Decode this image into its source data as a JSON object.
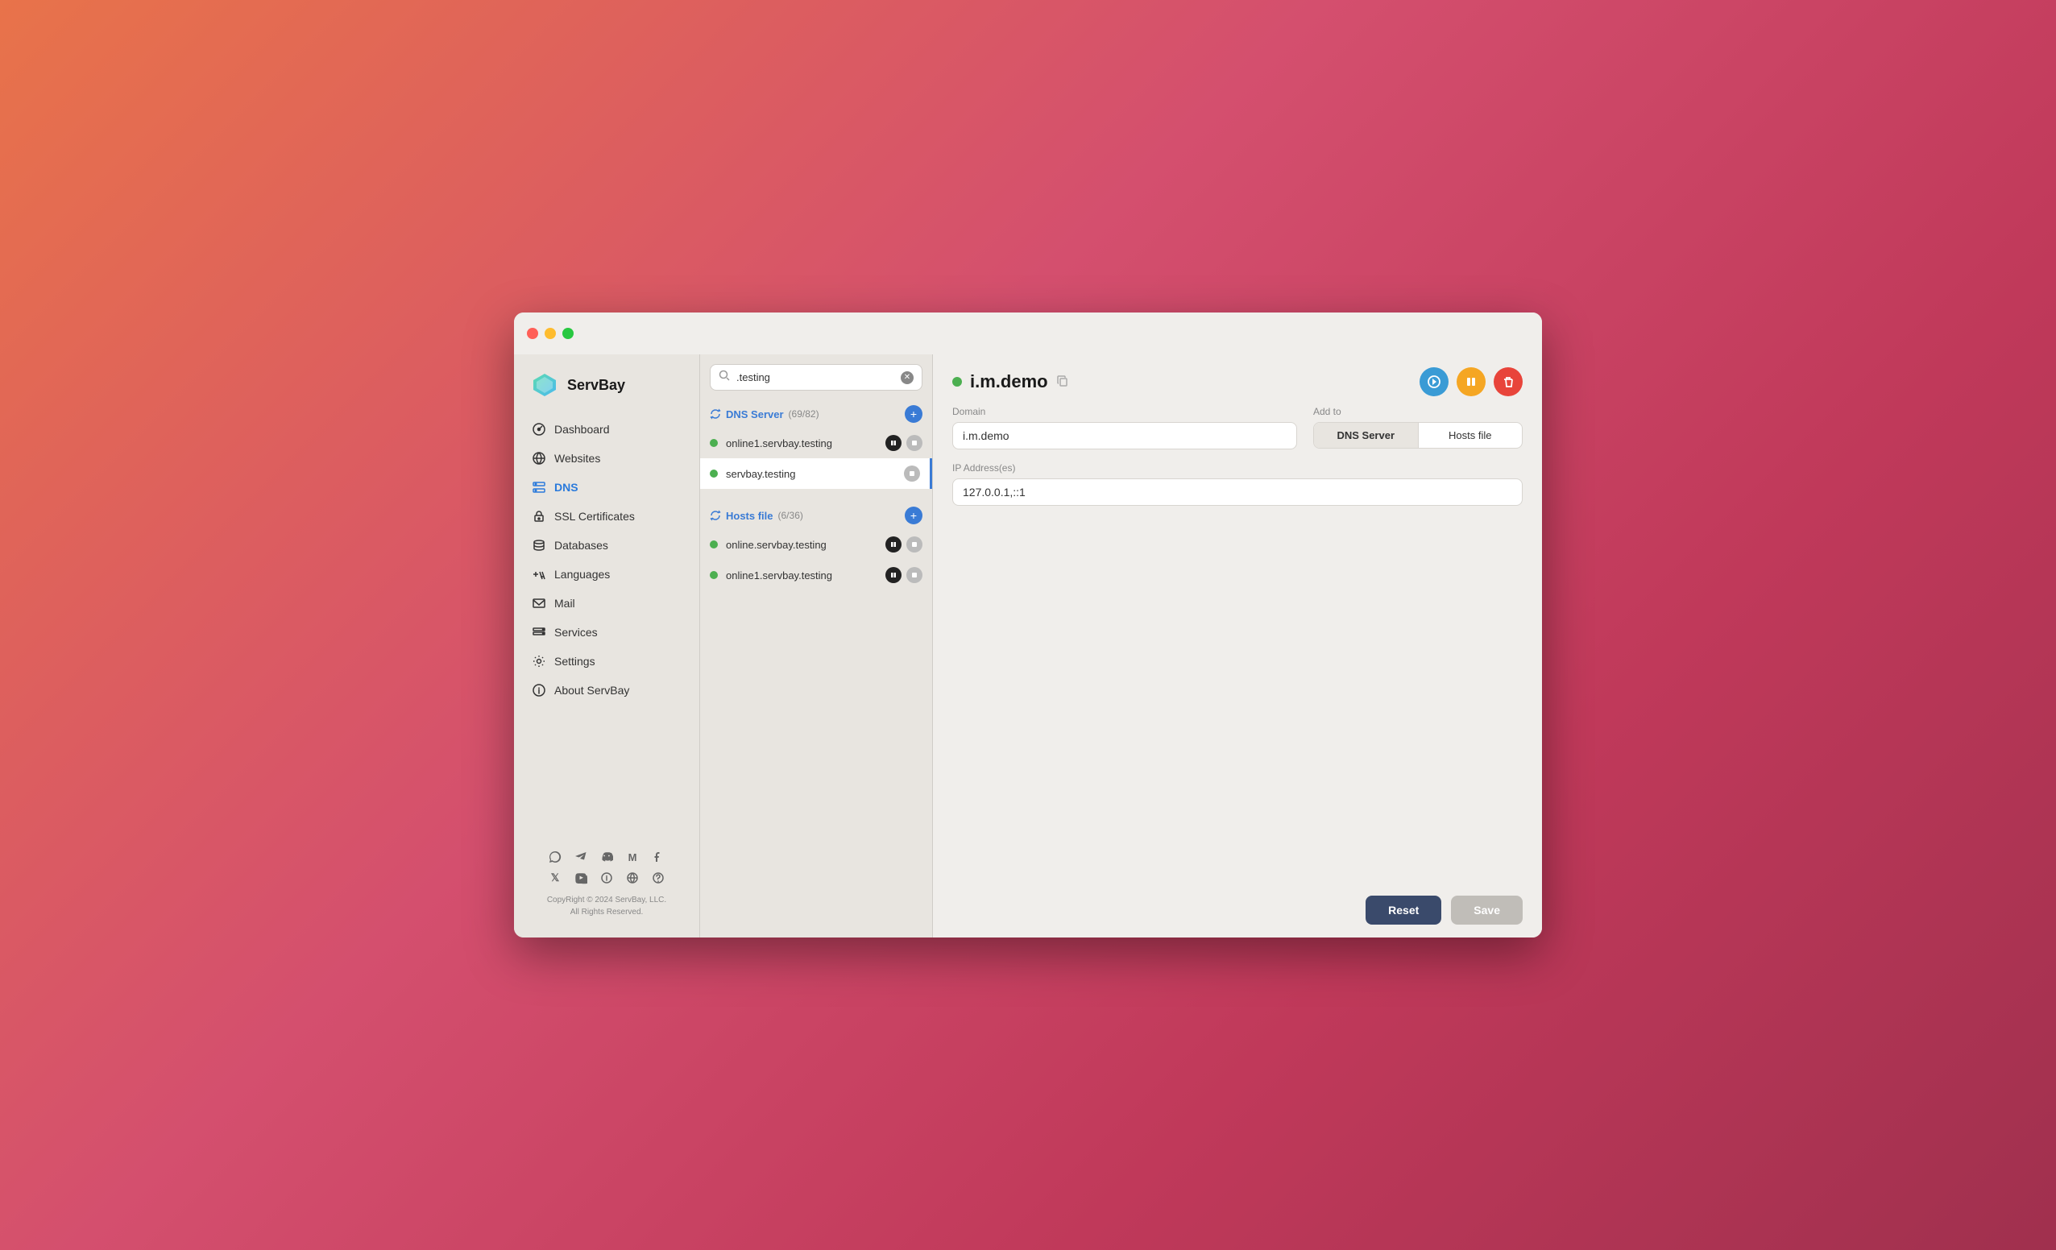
{
  "window": {
    "title": "ServBay"
  },
  "sidebar": {
    "logo_text": "ServBay",
    "nav_items": [
      {
        "id": "dashboard",
        "label": "Dashboard",
        "icon": "dashboard"
      },
      {
        "id": "websites",
        "label": "Websites",
        "icon": "websites"
      },
      {
        "id": "dns",
        "label": "DNS",
        "icon": "dns",
        "active": true
      },
      {
        "id": "ssl",
        "label": "SSL Certificates",
        "icon": "ssl"
      },
      {
        "id": "databases",
        "label": "Databases",
        "icon": "databases"
      },
      {
        "id": "languages",
        "label": "Languages",
        "icon": "languages"
      },
      {
        "id": "mail",
        "label": "Mail",
        "icon": "mail"
      },
      {
        "id": "services",
        "label": "Services",
        "icon": "services"
      },
      {
        "id": "settings",
        "label": "Settings",
        "icon": "settings"
      },
      {
        "id": "about",
        "label": "About ServBay",
        "icon": "about"
      }
    ],
    "copyright": "CopyRight © 2024 ServBay, LLC.\nAll Rights Reserved."
  },
  "middle_panel": {
    "search_placeholder": ".testing",
    "search_value": ".testing",
    "dns_group": {
      "label": "DNS Server",
      "count": "(69/82)"
    },
    "hosts_group": {
      "label": "Hosts file",
      "count": "(6/36)"
    },
    "dns_items": [
      {
        "label": "online1.servbay.testing",
        "active": true,
        "selected": false
      },
      {
        "label": "servbay.testing",
        "active": true,
        "selected": true
      }
    ],
    "hosts_items": [
      {
        "label": "online.servbay.testing",
        "active": true,
        "selected": false
      },
      {
        "label": "online1.servbay.testing",
        "active": true,
        "selected": false
      }
    ]
  },
  "main": {
    "record_name": "i.m.demo",
    "status": "active",
    "domain_label": "Domain",
    "domain_value": "i.m.demo",
    "add_to_label": "Add to",
    "add_to_options": [
      "DNS Server",
      "Hosts file"
    ],
    "add_to_selected": "DNS Server",
    "ip_label": "IP Address(es)",
    "ip_value": "127.0.0.1,::1",
    "btn_reset": "Reset",
    "btn_save": "Save"
  },
  "social": {
    "row1": [
      "whatsapp",
      "telegram",
      "discord",
      "medium",
      "facebook"
    ],
    "row2": [
      "twitter-x",
      "youtube",
      "info",
      "globe",
      "help"
    ]
  },
  "colors": {
    "active_nav": "#2a7adb",
    "group_color": "#3a7bd5",
    "status_green": "#4caf50",
    "btn_blue": "#3a9bd5",
    "btn_orange": "#f5a623",
    "btn_red": "#e8443a"
  }
}
